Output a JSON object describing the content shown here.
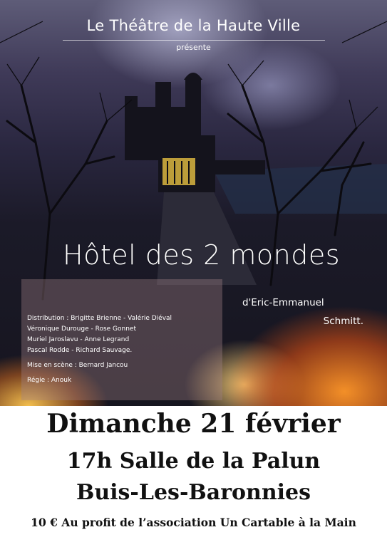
{
  "header": {
    "theatre": "Le Théâtre de la Haute Ville",
    "presents": "présente"
  },
  "play": {
    "title": "Hôtel des 2 mondes",
    "author_line1": "d'Eric-Emmanuel",
    "author_line2": "Schmitt."
  },
  "cast": {
    "line1": "Distribution : Brigitte Brienne - Valérie Diéval",
    "line2": "Véronique Durouge - Rose Gonnet",
    "line3": "Muriel Jaroslavu - Anne Legrand",
    "line4": "Pascal Rodde - Richard Sauvage.",
    "direction": "Mise en scène : Bernard Jancou",
    "stage": "Régie : Anouk"
  },
  "event": {
    "date": "Dimanche 21 février",
    "venue": "17h Salle de la Palun",
    "town": "Buis-Les-Baronnies",
    "price": "10 € Au profit de l’association Un Cartable à la Main"
  },
  "colors": {
    "sky": "#3f3a58",
    "warm": "#ff9628",
    "text_dark": "#111111",
    "text_light": "#ffffff"
  }
}
